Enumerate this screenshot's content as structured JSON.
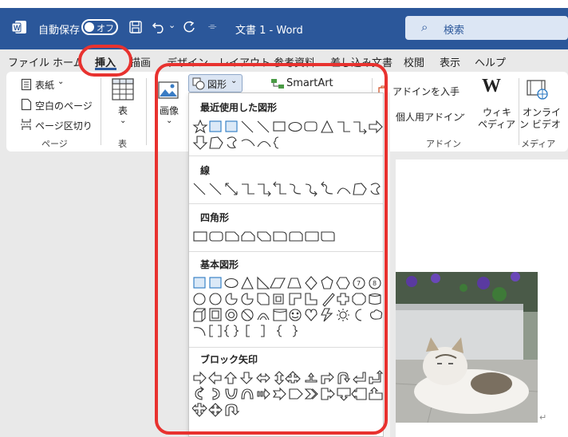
{
  "titlebar": {
    "autosave_label": "自動保存",
    "toggle_label": "オフ",
    "doc_title": "文書 1  -  Word",
    "search_placeholder": "検索"
  },
  "tabs": [
    "ファイル",
    "ホーム",
    "挿入",
    "描画",
    "デザイン",
    "レイアウト",
    "参考資料",
    "差し込み文書",
    "校閲",
    "表示",
    "ヘルプ"
  ],
  "ribbon": {
    "cover_page": "表紙",
    "blank_page": "空白のページ",
    "page_break": "ページ区切り",
    "group_pages": "ページ",
    "table": "表",
    "group_table": "表",
    "pictures": "画像",
    "shapes": "図形",
    "smartart": "SmartArt",
    "get_addins": "アドインを入手",
    "my_addins": "個人用アドイン",
    "wiki": "ウィキ",
    "wiki2": "ペディア",
    "group_addins": "アドイン",
    "online": "オンライ",
    "video": "ン ビデオ",
    "group_media": "メディア"
  },
  "dropdown": {
    "recent": "最近使用した図形",
    "lines": "線",
    "rectangles": "四角形",
    "basic": "基本図形",
    "block_arrows": "ブロック矢印"
  },
  "colors": {
    "brand": "#2b579a",
    "highlight": "#e8322f"
  }
}
